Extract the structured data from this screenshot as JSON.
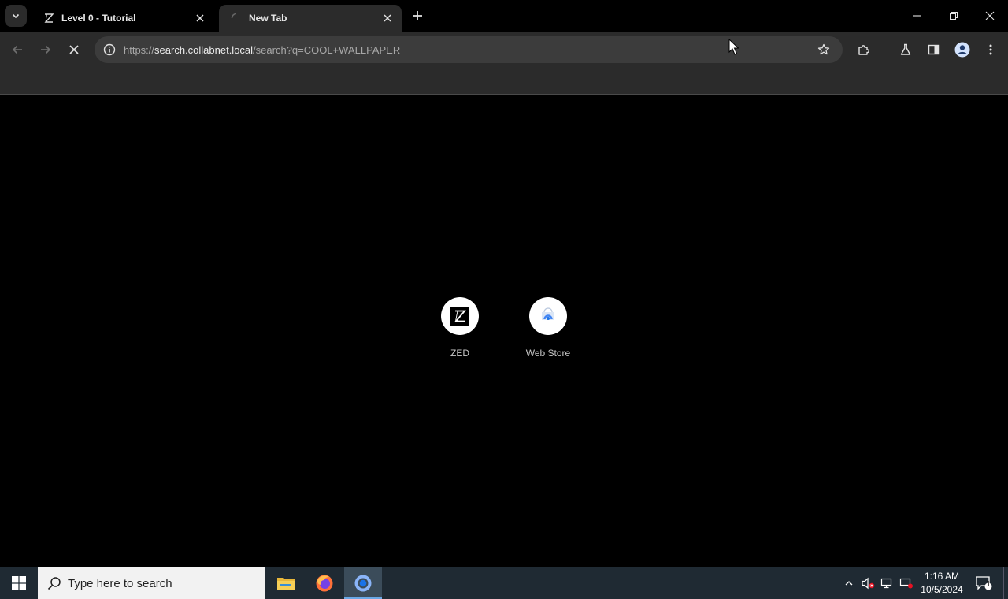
{
  "tabs": [
    {
      "title": "Level 0 - Tutorial",
      "active": false,
      "favicon": "zed-z-icon"
    },
    {
      "title": "New Tab",
      "active": true,
      "favicon": "loading-spinner-icon"
    }
  ],
  "toolbar": {
    "url_prefix": "https://",
    "url_host": "search.collabnet.local",
    "url_path": "/search?q=COOL+WALLPAPER"
  },
  "shortcuts": [
    {
      "label": "ZED",
      "icon": "zed-logo-icon"
    },
    {
      "label": "Web Store",
      "icon": "web-store-icon"
    }
  ],
  "taskbar": {
    "search_placeholder": "Type here to search",
    "apps": [
      "file-explorer-icon",
      "firefox-icon",
      "chrome-icon"
    ],
    "time": "1:16 AM",
    "date": "10/5/2024",
    "notification_count": "1"
  },
  "colors": {
    "chrome_frame": "#000000",
    "toolbar": "#2b2b2b",
    "omnibox": "#3c3c3c",
    "taskbar": "#1f2a33",
    "accent": "#6aa8e6"
  }
}
